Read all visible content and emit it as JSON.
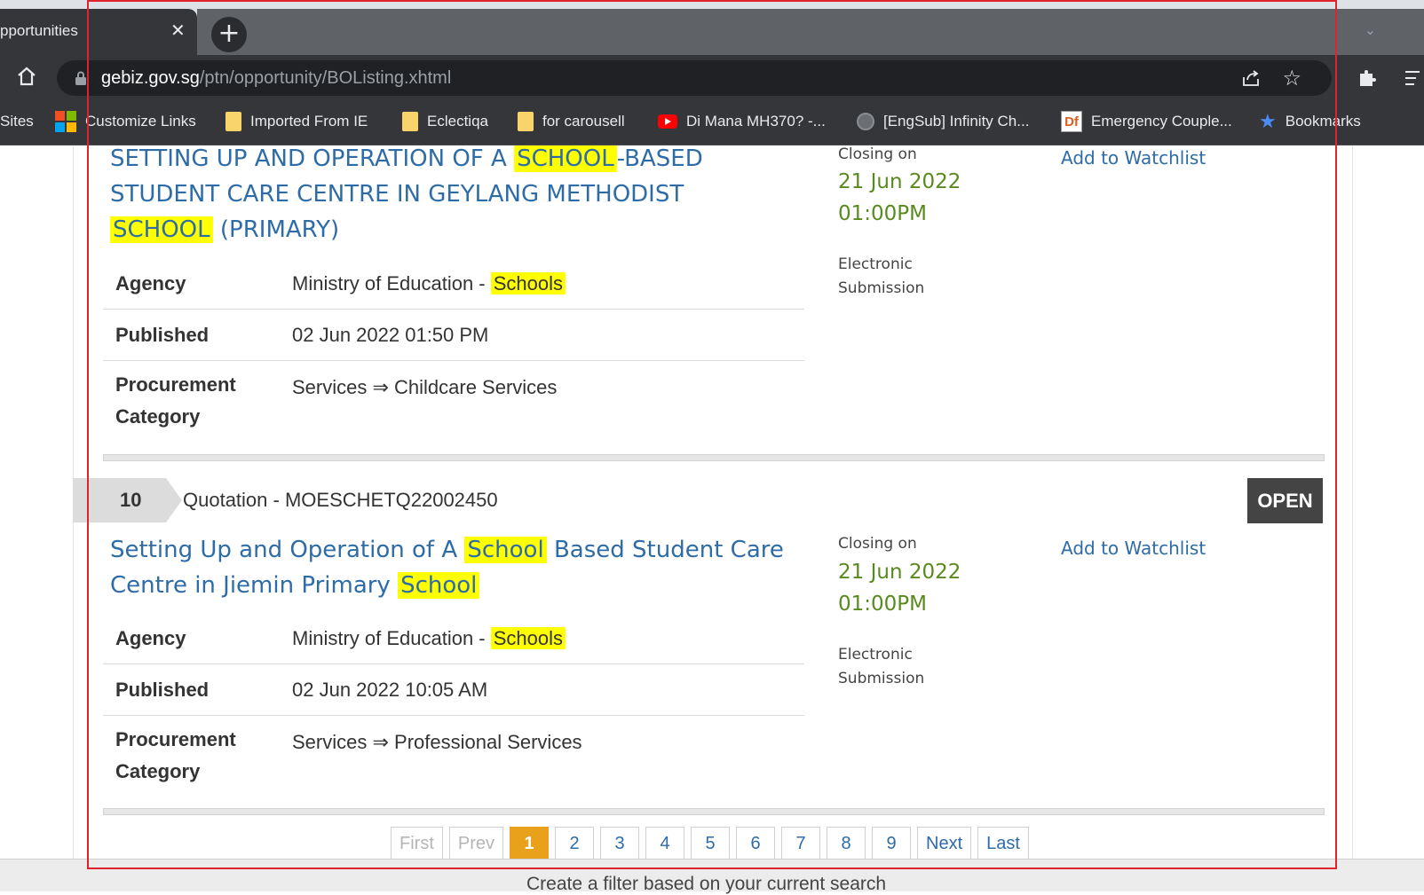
{
  "browser": {
    "tab_title": "pportunities",
    "new_tab": "+",
    "url_host": "gebiz.gov.sg",
    "url_path": "/ptn/opportunity/BOListing.xhtml"
  },
  "bookmarks": [
    {
      "label": "Sites"
    },
    {
      "label": "Customize Links"
    },
    {
      "label": "Imported From IE"
    },
    {
      "label": "Eclectiqa"
    },
    {
      "label": "for carousell"
    },
    {
      "label": "Di Mana MH370? -..."
    },
    {
      "label": "[EngSub] Infinity Ch..."
    },
    {
      "label": "Emergency Couple..."
    },
    {
      "label": "Bookmarks"
    }
  ],
  "cards": [
    {
      "title_parts": [
        "SETTING UP AND OPERATION OF A ",
        "SCHOOL",
        "-BASED STUDENT CARE CENTRE IN GEYLANG METHODIST ",
        "SCHOOL",
        " (PRIMARY)"
      ],
      "agency_label": "Agency",
      "agency_value": "Ministry of Education - ",
      "agency_highlight": "Schools",
      "published_label": "Published",
      "published_value": "02 Jun 2022 01:50 PM",
      "category_label_1": "Procurement",
      "category_label_2": "Category",
      "category_value": "Services ⇒ Childcare Services",
      "closing_label": "Closing on",
      "closing_date": "21 Jun 2022",
      "closing_time": "01:00PM",
      "submission_1": "Electronic",
      "submission_2": "Submission",
      "watchlist": "Add to Watchlist"
    },
    {
      "number": "10",
      "quotation": "Quotation - MOESCHETQ22002450",
      "status": "OPEN",
      "title_parts": [
        "Setting Up and Operation of A ",
        "School",
        " Based Student Care Centre in Jiemin Primary ",
        "School",
        ""
      ],
      "agency_label": "Agency",
      "agency_value": "Ministry of Education - ",
      "agency_highlight": "Schools",
      "published_label": "Published",
      "published_value": "02 Jun 2022 10:05 AM",
      "category_label_1": "Procurement",
      "category_label_2": "Category",
      "category_value": "Services ⇒ Professional Services",
      "closing_label": "Closing on",
      "closing_date": "21 Jun 2022",
      "closing_time": "01:00PM",
      "submission_1": "Electronic",
      "submission_2": "Submission",
      "watchlist": "Add to Watchlist"
    }
  ],
  "pagination": {
    "first": "First",
    "prev": "Prev",
    "pages": [
      "1",
      "2",
      "3",
      "4",
      "5",
      "6",
      "7",
      "8",
      "9"
    ],
    "current": "1",
    "next": "Next",
    "last": "Last"
  },
  "filter_bar": "Create a filter based on your current search",
  "colors": {
    "link": "#2e6ca8",
    "highlight": "#ffff00",
    "closing_green": "#5a8a1e",
    "active_page": "#e9a11b",
    "frame": "#e0222c"
  }
}
